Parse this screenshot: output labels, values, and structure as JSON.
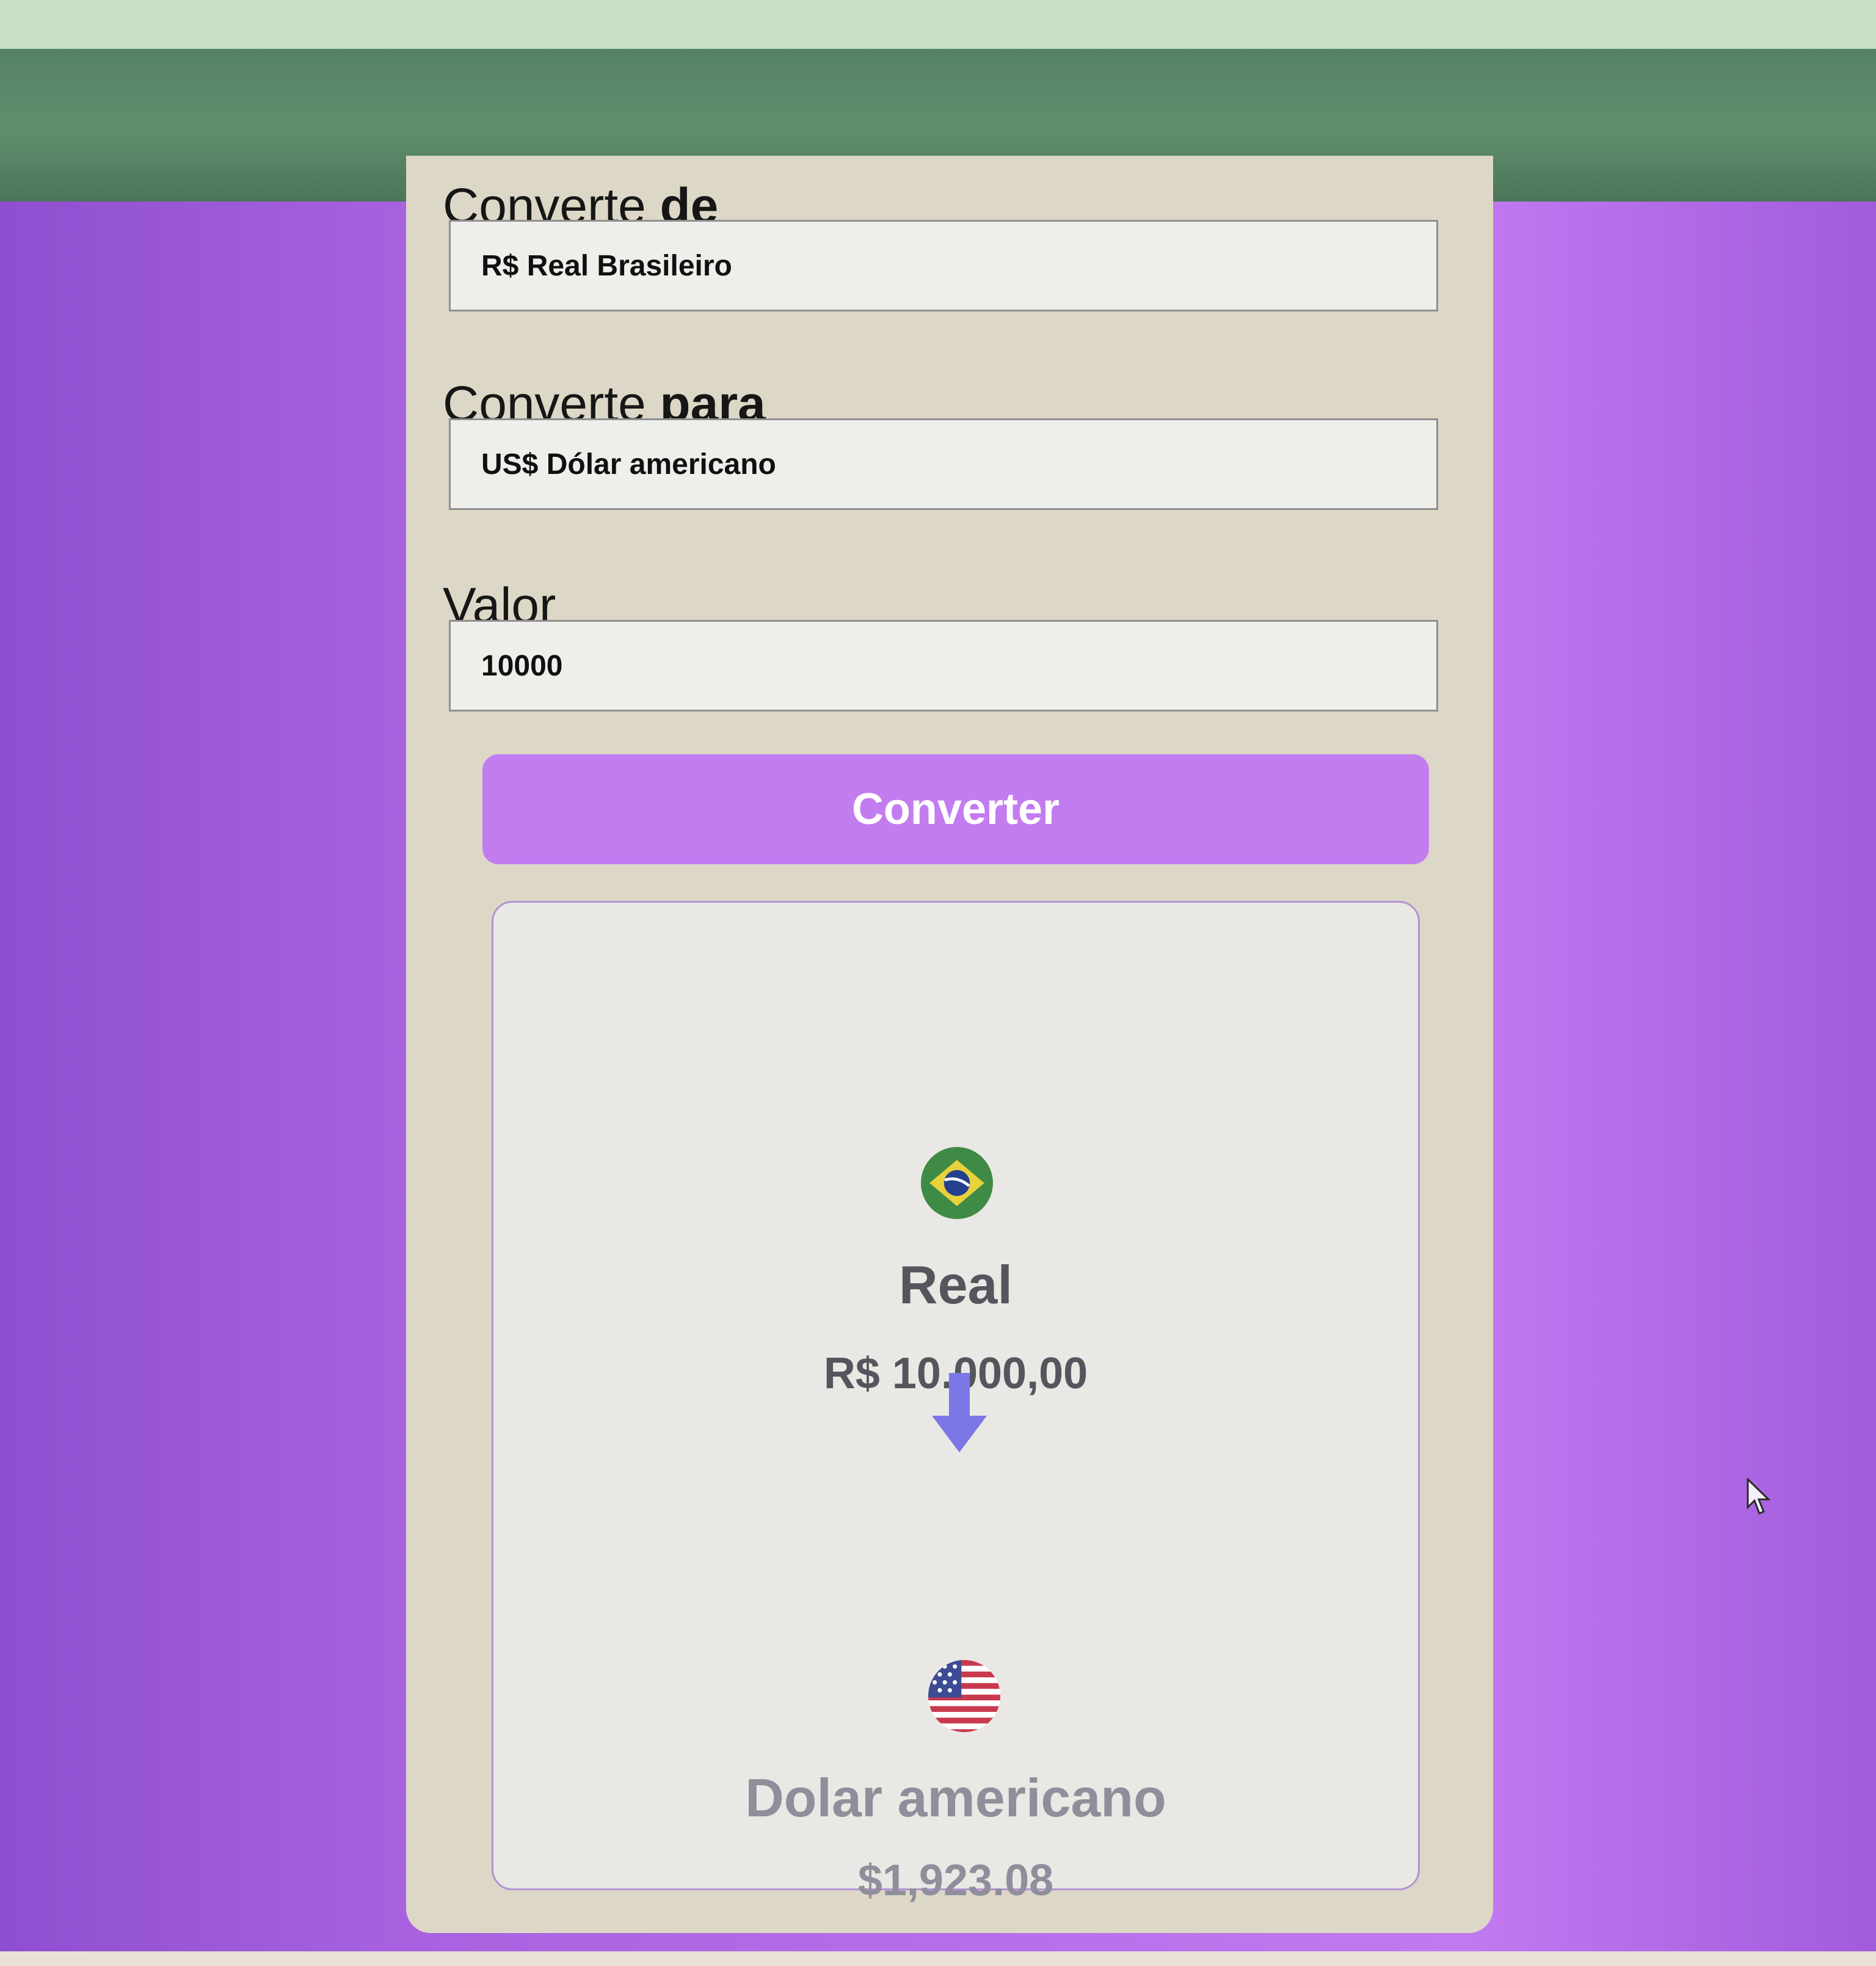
{
  "form": {
    "from": {
      "label_plain": "Converte",
      "label_bold": "de",
      "value": "R$ Real Brasileiro"
    },
    "to": {
      "label_plain": "Converte",
      "label_bold": "para",
      "value": "US$ Dólar americano"
    },
    "amount": {
      "label": "Valor",
      "value": "10000"
    },
    "convert_button": "Converter"
  },
  "result": {
    "source": {
      "name": "Real",
      "value": "R$ 10.000,00",
      "icon": "brazil-flag-icon"
    },
    "target": {
      "name": "Dolar americano",
      "value": "$1,923.08",
      "icon": "us-flag-icon"
    },
    "arrow_icon": "arrow-down-icon"
  },
  "colors": {
    "background": "#b56ee0",
    "card": "#ddd7c7",
    "button": "#c37cf0",
    "arrow": "#7b77e6",
    "source_text": "#55555d",
    "target_text": "#8f8f9b"
  }
}
